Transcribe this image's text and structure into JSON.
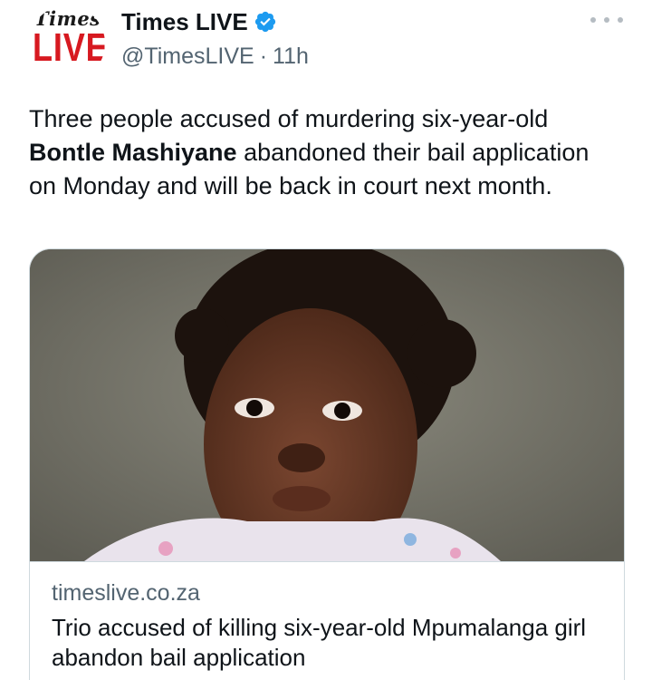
{
  "account": {
    "avatar_top": "Times",
    "avatar_bottom": "LIVE",
    "display_name": "Times LIVE",
    "verified_icon": "verified-badge-icon",
    "handle": "@TimesLIVE",
    "separator": "·",
    "time_ago": "11h"
  },
  "menu_icon": "more-options-icon",
  "tweet": {
    "text_before": "Three people accused of murdering six-year-old ",
    "text_bold": "Bontle Mashiyane",
    "text_after": " abandoned their bail application on Monday and will be back in court next month."
  },
  "card": {
    "domain": "timeslive.co.za",
    "title": "Trio accused of killing six-year-old Mpumalanga girl abandon bail application"
  },
  "colors": {
    "verified": "#1d9bf0",
    "logo_red": "#d71920",
    "secondary_text": "#536471",
    "border": "#cfd9de"
  }
}
